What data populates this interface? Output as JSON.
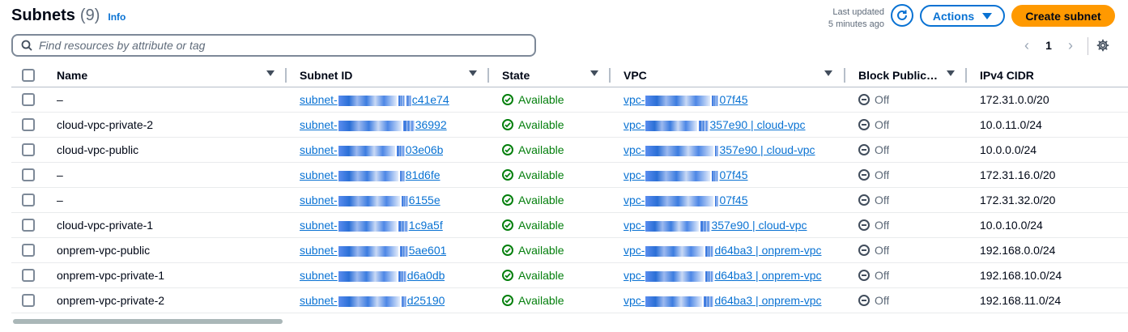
{
  "header": {
    "title": "Subnets",
    "count": "(9)",
    "info": "Info"
  },
  "last_updated": {
    "line1": "Last updated",
    "line2": "5 minutes ago"
  },
  "buttons": {
    "actions": "Actions",
    "create": "Create subnet"
  },
  "search": {
    "placeholder": "Find resources by attribute or tag"
  },
  "pagination": {
    "page": "1"
  },
  "columns": [
    "Name",
    "Subnet ID",
    "State",
    "VPC",
    "Block Public…",
    "IPv4 CIDR"
  ],
  "rows": [
    {
      "name": "–",
      "subnet_prefix": "subnet-",
      "subnet_suffix": "c41e74",
      "state": "Available",
      "vpc_prefix": "vpc-",
      "vpc_suffix": "07f45",
      "block": "Off",
      "cidr": "172.31.0.0/20"
    },
    {
      "name": "cloud-vpc-private-2",
      "subnet_prefix": "subnet-",
      "subnet_suffix": "36992",
      "state": "Available",
      "vpc_prefix": "vpc-",
      "vpc_suffix": "357e90 | cloud-vpc",
      "block": "Off",
      "cidr": "10.0.11.0/24"
    },
    {
      "name": "cloud-vpc-public",
      "subnet_prefix": "subnet-",
      "subnet_suffix": "03e06b",
      "state": "Available",
      "vpc_prefix": "vpc-",
      "vpc_suffix": "357e90 | cloud-vpc",
      "block": "Off",
      "cidr": "10.0.0.0/24"
    },
    {
      "name": "–",
      "subnet_prefix": "subnet-",
      "subnet_suffix": "81d6fe",
      "state": "Available",
      "vpc_prefix": "vpc-",
      "vpc_suffix": "07f45",
      "block": "Off",
      "cidr": "172.31.16.0/20"
    },
    {
      "name": "–",
      "subnet_prefix": "subnet-",
      "subnet_suffix": "6155e",
      "state": "Available",
      "vpc_prefix": "vpc-",
      "vpc_suffix": "07f45",
      "block": "Off",
      "cidr": "172.31.32.0/20"
    },
    {
      "name": "cloud-vpc-private-1",
      "subnet_prefix": "subnet-",
      "subnet_suffix": "1c9a5f",
      "state": "Available",
      "vpc_prefix": "vpc-",
      "vpc_suffix": "357e90 | cloud-vpc",
      "block": "Off",
      "cidr": "10.0.10.0/24"
    },
    {
      "name": "onprem-vpc-public",
      "subnet_prefix": "subnet-",
      "subnet_suffix": "5ae601",
      "state": "Available",
      "vpc_prefix": "vpc-",
      "vpc_suffix": "d64ba3 | onprem-vpc",
      "block": "Off",
      "cidr": "192.168.0.0/24"
    },
    {
      "name": "onprem-vpc-private-1",
      "subnet_prefix": "subnet-",
      "subnet_suffix": "d6a0db",
      "state": "Available",
      "vpc_prefix": "vpc-",
      "vpc_suffix": "d64ba3 | onprem-vpc",
      "block": "Off",
      "cidr": "192.168.10.0/24"
    },
    {
      "name": "onprem-vpc-private-2",
      "subnet_prefix": "subnet-",
      "subnet_suffix": "d25190",
      "state": "Available",
      "vpc_prefix": "vpc-",
      "vpc_suffix": "d64ba3 | onprem-vpc",
      "block": "Off",
      "cidr": "192.168.11.0/24"
    }
  ],
  "colors": {
    "link": "#0972d3",
    "success": "#037f0c",
    "primary_button": "#ff9900",
    "muted": "#5f6b7a"
  },
  "icons": {
    "search": "search-icon",
    "refresh": "refresh-icon",
    "settings": "gear-icon",
    "prev": "chevron-left-icon",
    "next": "chevron-right-icon",
    "available": "check-circle-icon",
    "off": "minus-circle-icon"
  }
}
